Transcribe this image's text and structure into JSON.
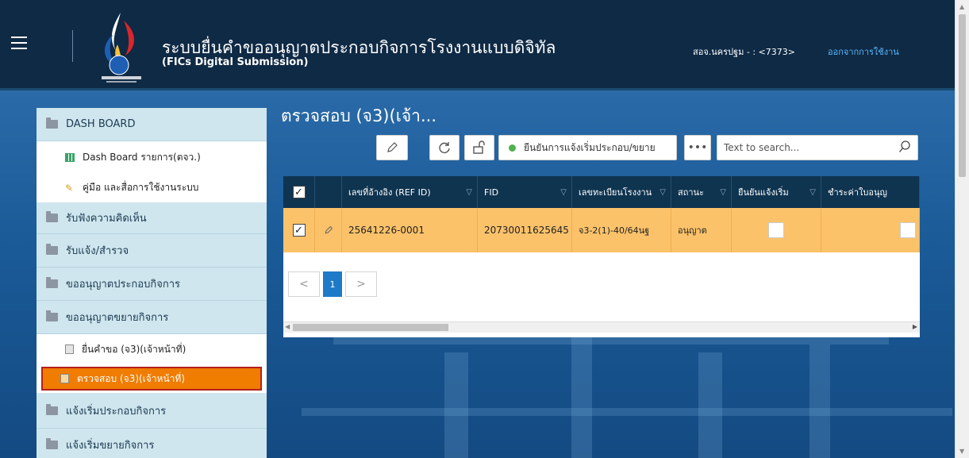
{
  "header": {
    "title": "ระบบยื่นคำขออนุญาตประกอบกิจการโรงงานแบบดิจิทัล",
    "subtitle": "(FICs Digital Submission)",
    "user": "สอจ.นครปฐม - : <7373>",
    "logout": "ออกจากการใช้งาน"
  },
  "sidebar": {
    "items": [
      {
        "label": "DASH BOARD",
        "icon": "folder-icon"
      },
      {
        "label": "Dash Board รายการ(ตจว.)",
        "icon": "grid-icon"
      },
      {
        "label": "คู่มือ และสื่อการใช้งานระบบ",
        "icon": "pencil-icon"
      },
      {
        "label": "รับฟังความคิดเห็น",
        "icon": "folder-icon"
      },
      {
        "label": "รับแจ้ง/สำรวจ",
        "icon": "folder-icon"
      },
      {
        "label": "ขออนุญาตประกอบกิจการ",
        "icon": "folder-icon"
      },
      {
        "label": "ขออนุญาตขยายกิจการ",
        "icon": "folder-icon"
      },
      {
        "label": "ยื่นคำขอ (จ3)(เจ้าหน้าที่)",
        "icon": "document-icon"
      },
      {
        "label": "ตรวจสอบ (จ3)(เจ้าหน้าที่)",
        "icon": "document-icon"
      },
      {
        "label": "แจ้งเริ่มประกอบกิจการ",
        "icon": "folder-icon"
      },
      {
        "label": "แจ้งเริ่มขยายกิจการ",
        "icon": "folder-icon"
      }
    ]
  },
  "main": {
    "page_title": "ตรวจสอบ (จ3)(เจ้า...",
    "toolbar": {
      "confirm_label": "ยืนยันการแจ้งเริ่มประกอบ/ขยาย",
      "more_label": "•••",
      "search_placeholder": "Text to search..."
    },
    "table": {
      "columns": [
        "เลขที่อ้างอิง (REF ID)",
        "FID",
        "เลขทะเบียนโรงงาน",
        "สถานะ",
        "ยืนยันแจ้งเริ่ม",
        "ชำระค่าใบอนุญ"
      ],
      "rows": [
        {
          "ref_id": "25641226-0001",
          "fid": "20730011625645",
          "factory_no": "จ3-2(1)-40/64นฐ",
          "status": "อนุญาต"
        }
      ]
    },
    "pager": {
      "current": "1",
      "prev": "<",
      "next": ">"
    }
  },
  "colors": {
    "header_bg": "#0f2a45",
    "accent": "#1e7ac8",
    "row_selected": "#fbc26a",
    "active_menu": "#f07c00"
  }
}
